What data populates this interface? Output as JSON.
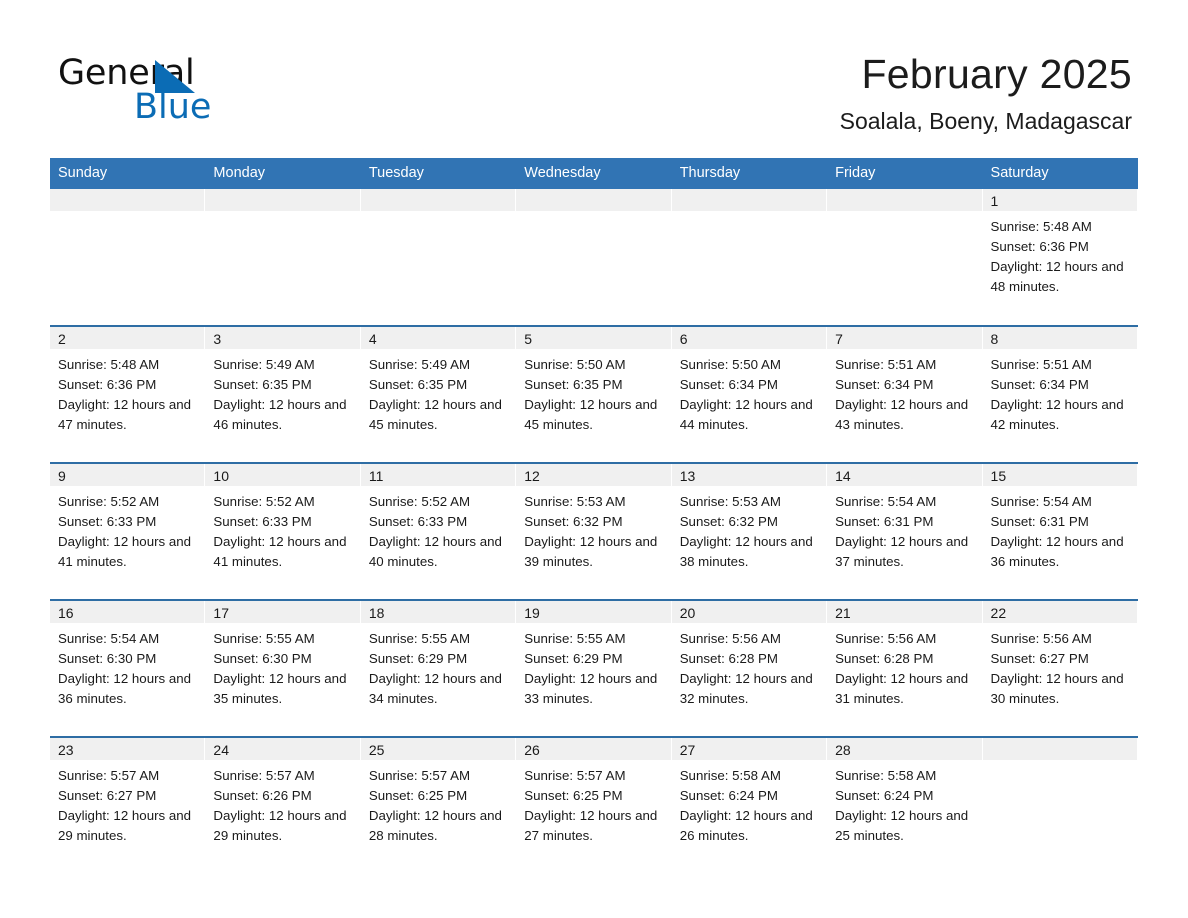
{
  "logo": {
    "word_black": "General",
    "word_blue": "Blue",
    "triangle_color": "#0b6cb5"
  },
  "header": {
    "title": "February 2025",
    "subtitle": "Soalala, Boeny, Madagascar",
    "accent_color": "#3174b4",
    "row_border_color": "#2e6da4",
    "daynum_band_color": "#f0f0f0"
  },
  "weekday_headers": [
    "Sunday",
    "Monday",
    "Tuesday",
    "Wednesday",
    "Thursday",
    "Friday",
    "Saturday"
  ],
  "weeks": [
    [
      {
        "day": "",
        "sunrise": "",
        "sunset": "",
        "daylight": ""
      },
      {
        "day": "",
        "sunrise": "",
        "sunset": "",
        "daylight": ""
      },
      {
        "day": "",
        "sunrise": "",
        "sunset": "",
        "daylight": ""
      },
      {
        "day": "",
        "sunrise": "",
        "sunset": "",
        "daylight": ""
      },
      {
        "day": "",
        "sunrise": "",
        "sunset": "",
        "daylight": ""
      },
      {
        "day": "",
        "sunrise": "",
        "sunset": "",
        "daylight": ""
      },
      {
        "day": "1",
        "sunrise": "Sunrise: 5:48 AM",
        "sunset": "Sunset: 6:36 PM",
        "daylight": "Daylight: 12 hours and 48 minutes."
      }
    ],
    [
      {
        "day": "2",
        "sunrise": "Sunrise: 5:48 AM",
        "sunset": "Sunset: 6:36 PM",
        "daylight": "Daylight: 12 hours and 47 minutes."
      },
      {
        "day": "3",
        "sunrise": "Sunrise: 5:49 AM",
        "sunset": "Sunset: 6:35 PM",
        "daylight": "Daylight: 12 hours and 46 minutes."
      },
      {
        "day": "4",
        "sunrise": "Sunrise: 5:49 AM",
        "sunset": "Sunset: 6:35 PM",
        "daylight": "Daylight: 12 hours and 45 minutes."
      },
      {
        "day": "5",
        "sunrise": "Sunrise: 5:50 AM",
        "sunset": "Sunset: 6:35 PM",
        "daylight": "Daylight: 12 hours and 45 minutes."
      },
      {
        "day": "6",
        "sunrise": "Sunrise: 5:50 AM",
        "sunset": "Sunset: 6:34 PM",
        "daylight": "Daylight: 12 hours and 44 minutes."
      },
      {
        "day": "7",
        "sunrise": "Sunrise: 5:51 AM",
        "sunset": "Sunset: 6:34 PM",
        "daylight": "Daylight: 12 hours and 43 minutes."
      },
      {
        "day": "8",
        "sunrise": "Sunrise: 5:51 AM",
        "sunset": "Sunset: 6:34 PM",
        "daylight": "Daylight: 12 hours and 42 minutes."
      }
    ],
    [
      {
        "day": "9",
        "sunrise": "Sunrise: 5:52 AM",
        "sunset": "Sunset: 6:33 PM",
        "daylight": "Daylight: 12 hours and 41 minutes."
      },
      {
        "day": "10",
        "sunrise": "Sunrise: 5:52 AM",
        "sunset": "Sunset: 6:33 PM",
        "daylight": "Daylight: 12 hours and 41 minutes."
      },
      {
        "day": "11",
        "sunrise": "Sunrise: 5:52 AM",
        "sunset": "Sunset: 6:33 PM",
        "daylight": "Daylight: 12 hours and 40 minutes."
      },
      {
        "day": "12",
        "sunrise": "Sunrise: 5:53 AM",
        "sunset": "Sunset: 6:32 PM",
        "daylight": "Daylight: 12 hours and 39 minutes."
      },
      {
        "day": "13",
        "sunrise": "Sunrise: 5:53 AM",
        "sunset": "Sunset: 6:32 PM",
        "daylight": "Daylight: 12 hours and 38 minutes."
      },
      {
        "day": "14",
        "sunrise": "Sunrise: 5:54 AM",
        "sunset": "Sunset: 6:31 PM",
        "daylight": "Daylight: 12 hours and 37 minutes."
      },
      {
        "day": "15",
        "sunrise": "Sunrise: 5:54 AM",
        "sunset": "Sunset: 6:31 PM",
        "daylight": "Daylight: 12 hours and 36 minutes."
      }
    ],
    [
      {
        "day": "16",
        "sunrise": "Sunrise: 5:54 AM",
        "sunset": "Sunset: 6:30 PM",
        "daylight": "Daylight: 12 hours and 36 minutes."
      },
      {
        "day": "17",
        "sunrise": "Sunrise: 5:55 AM",
        "sunset": "Sunset: 6:30 PM",
        "daylight": "Daylight: 12 hours and 35 minutes."
      },
      {
        "day": "18",
        "sunrise": "Sunrise: 5:55 AM",
        "sunset": "Sunset: 6:29 PM",
        "daylight": "Daylight: 12 hours and 34 minutes."
      },
      {
        "day": "19",
        "sunrise": "Sunrise: 5:55 AM",
        "sunset": "Sunset: 6:29 PM",
        "daylight": "Daylight: 12 hours and 33 minutes."
      },
      {
        "day": "20",
        "sunrise": "Sunrise: 5:56 AM",
        "sunset": "Sunset: 6:28 PM",
        "daylight": "Daylight: 12 hours and 32 minutes."
      },
      {
        "day": "21",
        "sunrise": "Sunrise: 5:56 AM",
        "sunset": "Sunset: 6:28 PM",
        "daylight": "Daylight: 12 hours and 31 minutes."
      },
      {
        "day": "22",
        "sunrise": "Sunrise: 5:56 AM",
        "sunset": "Sunset: 6:27 PM",
        "daylight": "Daylight: 12 hours and 30 minutes."
      }
    ],
    [
      {
        "day": "23",
        "sunrise": "Sunrise: 5:57 AM",
        "sunset": "Sunset: 6:27 PM",
        "daylight": "Daylight: 12 hours and 29 minutes."
      },
      {
        "day": "24",
        "sunrise": "Sunrise: 5:57 AM",
        "sunset": "Sunset: 6:26 PM",
        "daylight": "Daylight: 12 hours and 29 minutes."
      },
      {
        "day": "25",
        "sunrise": "Sunrise: 5:57 AM",
        "sunset": "Sunset: 6:25 PM",
        "daylight": "Daylight: 12 hours and 28 minutes."
      },
      {
        "day": "26",
        "sunrise": "Sunrise: 5:57 AM",
        "sunset": "Sunset: 6:25 PM",
        "daylight": "Daylight: 12 hours and 27 minutes."
      },
      {
        "day": "27",
        "sunrise": "Sunrise: 5:58 AM",
        "sunset": "Sunset: 6:24 PM",
        "daylight": "Daylight: 12 hours and 26 minutes."
      },
      {
        "day": "28",
        "sunrise": "Sunrise: 5:58 AM",
        "sunset": "Sunset: 6:24 PM",
        "daylight": "Daylight: 12 hours and 25 minutes."
      },
      {
        "day": "",
        "sunrise": "",
        "sunset": "",
        "daylight": ""
      }
    ]
  ]
}
